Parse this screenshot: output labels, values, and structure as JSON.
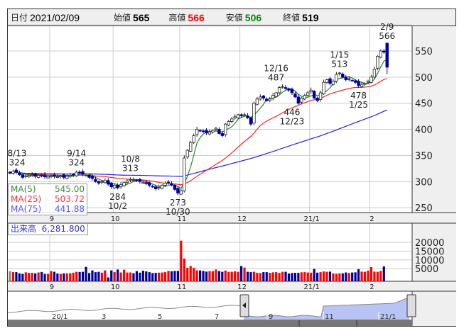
{
  "header": {
    "date_label": "日付",
    "date": "2021/02/09",
    "open_label": "始値",
    "open": "565",
    "high_label": "高値",
    "high": "566",
    "low_label": "安値",
    "low": "506",
    "close_label": "終値",
    "close": "519"
  },
  "colors": {
    "up_fill": "#ffffff",
    "down_fill": "#000099",
    "ma5": "#228822",
    "ma25": "#ff2020",
    "ma75": "#2020ee",
    "vol_up": "#ff0000",
    "vol_down": "#000099",
    "vol_flat": "#888888",
    "nav_fill": "#b8c4f4"
  },
  "legend": {
    "ma5_label": "MA(5)",
    "ma5": "545.00",
    "ma25_label": "MA(25)",
    "ma25": "503.72",
    "ma75_label": "MA(75)",
    "ma75": "441.88"
  },
  "volume_box": {
    "label": "出来高",
    "value": "6,281.800"
  },
  "chart_data": {
    "type": "candlestick",
    "price_axis": {
      "ticks": [
        250,
        300,
        350,
        400,
        450,
        500,
        550
      ],
      "ylim": [
        240,
        600
      ]
    },
    "month_ticks": [
      {
        "label": "9",
        "index": 13
      },
      {
        "label": "10",
        "index": 33
      },
      {
        "label": "11",
        "index": 54
      },
      {
        "label": "12",
        "index": 73
      },
      {
        "label": "21/1",
        "index": 95
      },
      {
        "label": "2",
        "index": 114
      }
    ],
    "closes": [
      316,
      320,
      318,
      313,
      308,
      311,
      312,
      313,
      310,
      312,
      311,
      309,
      310,
      311,
      310,
      309,
      311,
      308,
      310,
      312,
      313,
      318,
      317,
      314,
      312,
      308,
      306,
      300,
      297,
      300,
      302,
      295,
      290,
      293,
      288,
      294,
      298,
      301,
      304,
      303,
      302,
      300,
      298,
      296,
      293,
      290,
      286,
      289,
      293,
      297,
      298,
      293,
      285,
      278,
      282,
      345,
      360,
      375,
      388,
      400,
      397,
      396,
      393,
      395,
      398,
      402,
      392,
      388,
      410,
      415,
      420,
      424,
      428,
      426,
      428,
      422,
      410,
      450,
      458,
      462,
      460,
      455,
      458,
      465,
      470,
      480,
      482,
      478,
      475,
      470,
      462,
      450,
      460,
      465,
      470,
      475,
      460,
      455,
      470,
      490,
      495,
      488,
      492,
      505,
      508,
      500,
      495,
      496,
      493,
      490,
      484,
      486,
      488,
      492,
      500,
      515,
      540,
      550,
      548,
      519
    ],
    "last_candle": {
      "open": 565,
      "high": 566,
      "low": 506,
      "close": 519
    },
    "annotations": [
      {
        "date": "8/13",
        "value": "324",
        "index": 0,
        "kind": "high"
      },
      {
        "date": "9/14",
        "value": "324",
        "index": 21,
        "kind": "high"
      },
      {
        "date": "10/2",
        "value": "284",
        "index": 34,
        "kind": "low"
      },
      {
        "date": "10/8",
        "value": "313",
        "index": 38,
        "kind": "high"
      },
      {
        "date": "10/30",
        "value": "273",
        "index": 53,
        "kind": "low"
      },
      {
        "date": "12/16",
        "value": "487",
        "index": 84,
        "kind": "high"
      },
      {
        "date": "12/23",
        "value": "446",
        "index": 89,
        "kind": "low"
      },
      {
        "date": "1/15",
        "value": "513",
        "index": 104,
        "kind": "high"
      },
      {
        "date": "1/25",
        "value": "478",
        "index": 110,
        "kind": "low"
      },
      {
        "date": "2/9",
        "value": "566",
        "index": 119,
        "kind": "high"
      }
    ],
    "volume_axis": {
      "ticks": [
        5000,
        10000,
        15000,
        20000
      ]
    },
    "volumes": [
      3600,
      3000,
      3000,
      2300,
      2000,
      2900,
      2600,
      2600,
      2300,
      2800,
      3100,
      2000,
      2000,
      3600,
      3200,
      2200,
      2000,
      2300,
      2300,
      2400,
      2700,
      3200,
      3100,
      3200,
      6000,
      2500,
      4000,
      3000,
      3200,
      2700,
      4000,
      0,
      4000,
      3000,
      4500,
      2800,
      4400,
      2800,
      2800,
      2400,
      3600,
      2700,
      3800,
      3400,
      3000,
      2500,
      2600,
      2700,
      2800,
      3000,
      3700,
      3500,
      3700,
      3700,
      21000,
      10800,
      5500,
      6500,
      5500,
      4000,
      4000,
      3700,
      3300,
      3600,
      3600,
      4500,
      3600,
      3200,
      3900,
      3200,
      3200,
      3500,
      3200,
      6500,
      5600,
      3200,
      3000,
      3200,
      2600,
      2500,
      3000,
      3000,
      2600,
      2900,
      3000,
      2600,
      3200,
      3200,
      2200,
      2500,
      2600,
      2600,
      2900,
      3000,
      2800,
      2700,
      4800,
      2700,
      3000,
      3400,
      3200,
      3300,
      2300,
      2100,
      2300,
      2300,
      2800,
      2500,
      2800,
      2900,
      4700,
      3300,
      3200,
      3900,
      5900,
      3300,
      3200,
      3700,
      6281.8
    ],
    "navigator": {
      "labels": [
        "20/1",
        "3",
        "5",
        "7",
        "9",
        "11",
        "21/1"
      ]
    }
  }
}
